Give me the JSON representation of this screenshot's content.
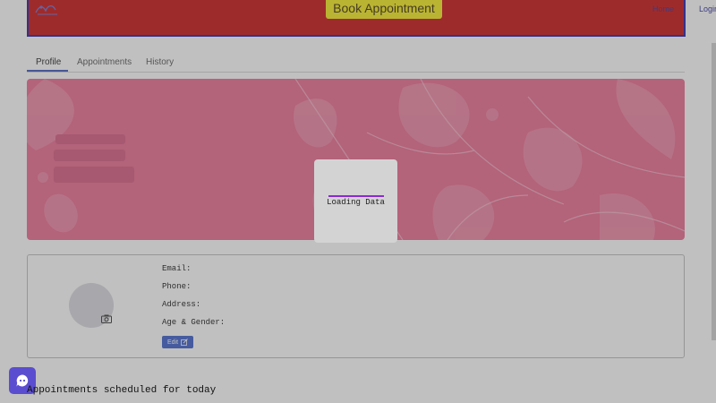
{
  "header": {
    "book_label": "Book Appointment",
    "nav": [
      "Home",
      "Login"
    ]
  },
  "tabs": [
    {
      "label": "Profile",
      "active": true
    },
    {
      "label": "Appointments",
      "active": false
    },
    {
      "label": "History",
      "active": false
    }
  ],
  "loader": {
    "text": "Loading Data"
  },
  "profile": {
    "fields": [
      "Email:",
      "Phone:",
      "Address:",
      "Age & Gender:"
    ],
    "edit_label": "Edit"
  },
  "appointments": {
    "title": "Appointments scheduled for today"
  },
  "colors": {
    "header_bg": "#c81010",
    "header_border": "#1d1ba8",
    "book_button": "#f5ec1c",
    "banner": "#ea6a8f",
    "accent": "#3a5dca",
    "loader_bar": "#8a2bd0"
  }
}
